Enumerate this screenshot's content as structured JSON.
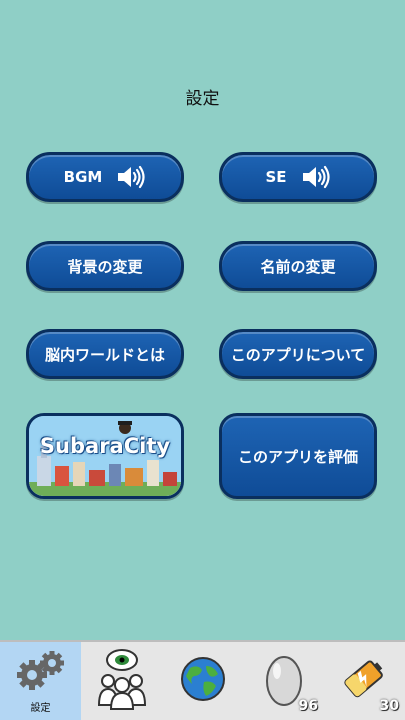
{
  "header": {
    "title": "設定"
  },
  "buttons": {
    "bgm": {
      "label": "BGM",
      "icon": "speaker-icon"
    },
    "se": {
      "label": "SE",
      "icon": "speaker-icon"
    },
    "background": "背景の変更",
    "name": "名前の変更",
    "brain_world": "脳内ワールドとは",
    "about": "このアプリについて",
    "subaracity": {
      "logo_text": "SubaraCity"
    },
    "rate": "このアプリを評価"
  },
  "tabbar": {
    "settings": {
      "label": "設定",
      "icon": "gears-icon"
    },
    "people": {
      "icon": "people-eye-icon"
    },
    "world": {
      "icon": "earth-icon"
    },
    "egg": {
      "icon": "egg-icon",
      "count": "96"
    },
    "battery": {
      "icon": "battery-icon",
      "count": "30"
    }
  },
  "colors": {
    "background": "#8fcfc6",
    "button_fill": "#1a5ca8",
    "button_border": "#0a2f5e",
    "active_tab": "#b3d6f3"
  }
}
